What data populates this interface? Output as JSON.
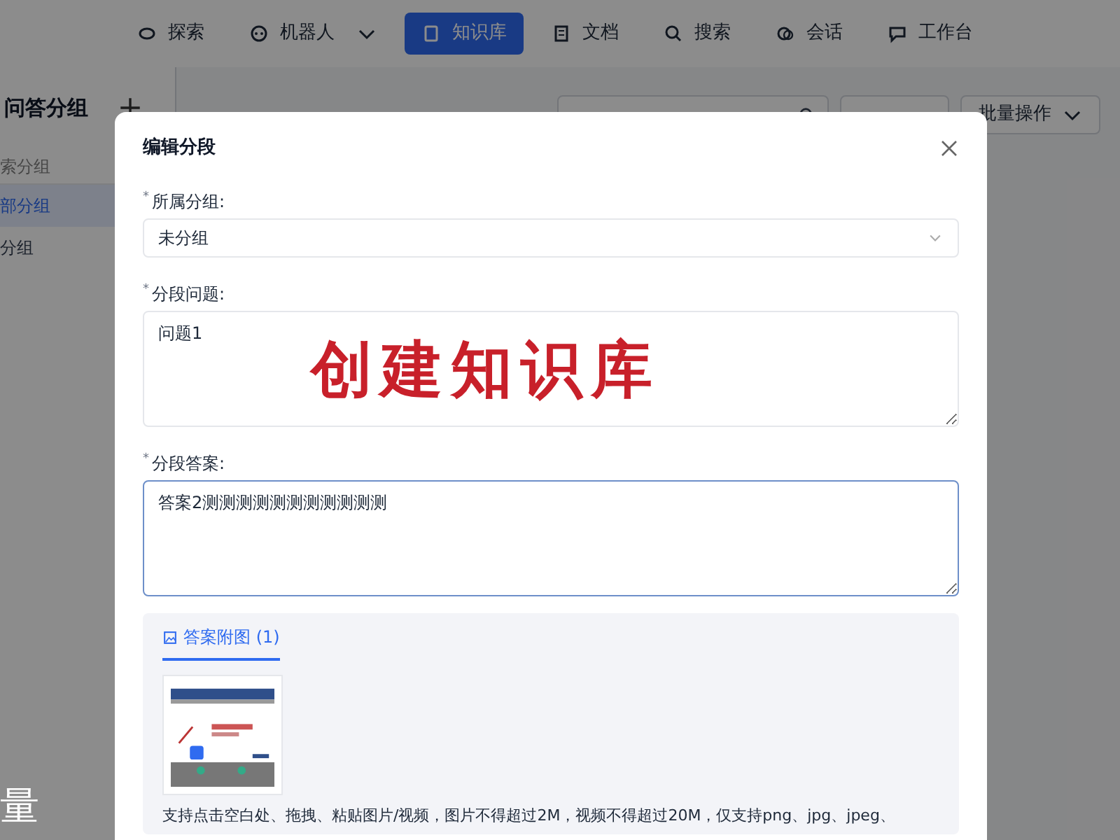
{
  "nav": {
    "items": [
      {
        "label": "探索",
        "selected": false,
        "dropdown": false
      },
      {
        "label": "机器人",
        "selected": false,
        "dropdown": true
      },
      {
        "label": "知识库",
        "selected": true,
        "dropdown": false
      },
      {
        "label": "文档",
        "selected": false,
        "dropdown": false
      },
      {
        "label": "搜索",
        "selected": false,
        "dropdown": false
      },
      {
        "label": "会话",
        "selected": false,
        "dropdown": false
      },
      {
        "label": "工作台",
        "selected": false,
        "dropdown": false
      }
    ]
  },
  "sidebar": {
    "title": "问答分组",
    "search_placeholder": "索分组",
    "items": [
      {
        "label": "部分组",
        "selected": true
      },
      {
        "label": "分组",
        "selected": false
      }
    ]
  },
  "toolbar": {
    "batch_button": "批量操作"
  },
  "dialog": {
    "title": "编辑分段",
    "fields": [
      {
        "kind": "select",
        "required_mark": "*",
        "label": "所属分组:",
        "value": "未分组",
        "focused": false
      },
      {
        "kind": "textarea",
        "required_mark": "*",
        "label": "分段问题:",
        "value": "问题1",
        "focused": false
      },
      {
        "kind": "textarea",
        "required_mark": "*",
        "label": "分段答案:",
        "value": "答案2测测测测测测测测测测测",
        "focused": true
      }
    ],
    "attachments": {
      "tab": "答案附图 (1)",
      "help": "支持点击空白处、拖拽、粘贴图片/视频，图片不得超过2M，视频不得超过20M，仅支持png、jpg、jpeg、"
    }
  },
  "overlay_caption": "创建知识库",
  "overlay_subtitle": "量"
}
